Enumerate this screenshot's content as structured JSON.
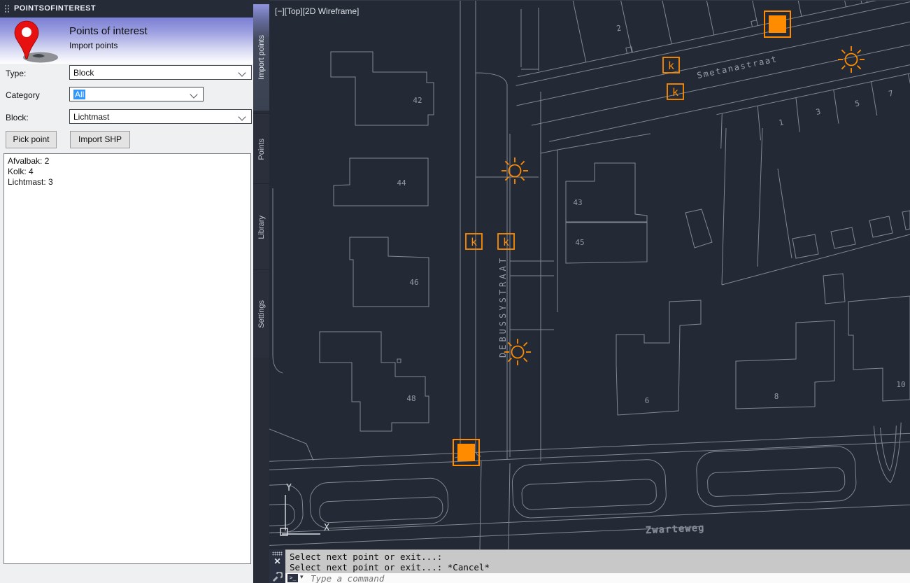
{
  "panel": {
    "titlebar": "POINTSOFINTEREST",
    "header": {
      "title": "Points of interest",
      "subtitle": "Import points"
    },
    "form": {
      "type_label": "Type:",
      "type_value": "Block",
      "category_label": "Category",
      "category_value": "All",
      "block_label": "Block:",
      "block_value": "Lichtmast",
      "pick_point": "Pick point",
      "import_shp": "Import SHP"
    },
    "summary": [
      "Afvalbak: 2",
      "Kolk: 4",
      "Lichtmast: 3"
    ],
    "tabs": [
      {
        "label": "Import points",
        "active": true
      },
      {
        "label": "Points",
        "active": false
      },
      {
        "label": "Library",
        "active": false
      },
      {
        "label": "Settings",
        "active": false
      }
    ]
  },
  "viewport": {
    "label": "[−][Top][2D Wireframe]",
    "streets": {
      "top": "Smetanastraat",
      "vertical": "DEBUSSYSTRAAT",
      "bottom": "Zwarteweg"
    },
    "house_numbers": [
      "42",
      "44",
      "46",
      "48",
      "43",
      "45",
      "2",
      "1",
      "3",
      "5",
      "7",
      "6",
      "8",
      "10"
    ],
    "markers": {
      "kolk_glyph": "k",
      "afvalbak_count": 2,
      "kolk_count": 4,
      "lichtmast_count": 3,
      "orange": "#ff8c00"
    },
    "ucs": {
      "x": "X",
      "y": "Y"
    },
    "colors": {
      "canvas_bg": "#242a35",
      "line_gray": "#808792"
    }
  },
  "command": {
    "lines": [
      "Select next point or exit...:",
      "Select next point or exit...: *Cancel*"
    ],
    "placeholder": "Type a command",
    "prompt_glyph": ">_",
    "dropdown_glyph": "▾",
    "close_glyph": "✕"
  }
}
